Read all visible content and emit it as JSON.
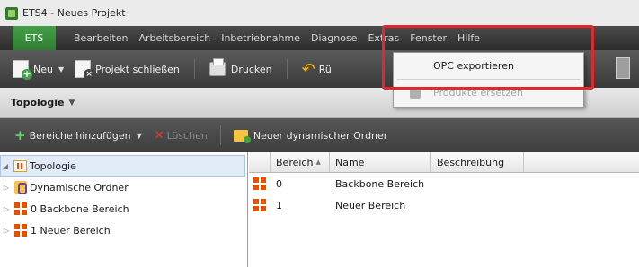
{
  "window": {
    "title": "ETS4 - Neues Projekt"
  },
  "menubar": {
    "ets_label": "ETS",
    "items": [
      "Bearbeiten",
      "Arbeitsbereich",
      "Inbetriebnahme",
      "Diagnose",
      "Extras",
      "Fenster",
      "Hilfe"
    ]
  },
  "toolbar": {
    "new_label": "Neu",
    "close_project_label": "Projekt schließen",
    "print_label": "Drucken",
    "undo_label": "Rü"
  },
  "extras_menu": {
    "items": [
      {
        "label": "OPC exportieren",
        "enabled": true
      },
      {
        "label": "Produkte ersetzen",
        "enabled": false
      }
    ]
  },
  "panel": {
    "title": "Topologie",
    "toolbar": {
      "add_areas_label": "Bereiche hinzufügen",
      "delete_label": "Löschen",
      "new_dynamic_folder_label": "Neuer dynamischer Ordner"
    }
  },
  "tree": {
    "root": "Topologie",
    "items": [
      "Dynamische Ordner",
      "0 Backbone Bereich",
      "1 Neuer Bereich"
    ]
  },
  "table": {
    "columns": [
      "Bereich",
      "Name",
      "Beschreibung"
    ],
    "rows": [
      {
        "bereich": "0",
        "name": "Backbone Bereich",
        "beschreibung": ""
      },
      {
        "bereich": "1",
        "name": "Neuer Bereich",
        "beschreibung": ""
      }
    ]
  },
  "colors": {
    "highlight": "#e1282e",
    "ets_green": "#2e7d32",
    "area_orange": "#e65100"
  },
  "icons": {
    "app": "ets-app-icon",
    "new": "new-document-icon",
    "close_project": "close-project-icon",
    "print": "printer-icon",
    "undo": "undo-icon",
    "add": "plus-icon",
    "delete": "delete-x-icon",
    "dynamic_folder": "dynamic-folder-icon",
    "topology": "topology-icon",
    "area": "area-icon"
  }
}
